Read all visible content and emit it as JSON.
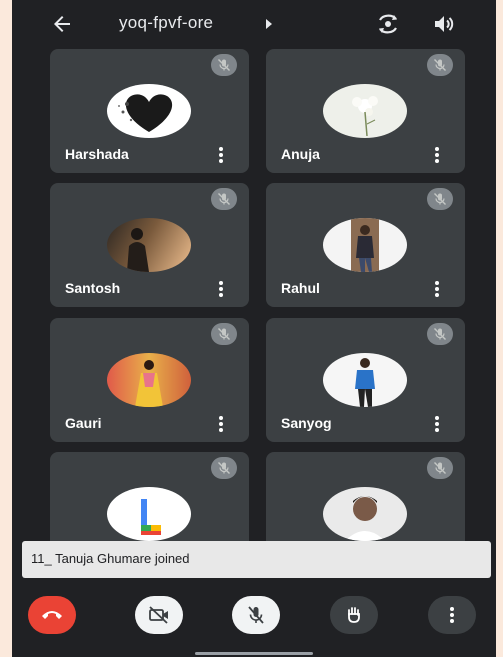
{
  "meeting": {
    "code": "yoq-fpvf-ore"
  },
  "participants": [
    {
      "name": "Harshada"
    },
    {
      "name": "Anuja"
    },
    {
      "name": "Santosh"
    },
    {
      "name": "Rahul"
    },
    {
      "name": "Gauri"
    },
    {
      "name": "Sanyog"
    },
    {
      "name": ""
    },
    {
      "name": ""
    }
  ],
  "toast": {
    "message": "11_ Tanuja Ghumare joined"
  },
  "colors": {
    "background": "#202124",
    "tile": "#3c4043",
    "end_call": "#ea4335",
    "mute_badge": "#80868b"
  },
  "icons": {
    "back": "arrow-left-icon",
    "caret": "caret-right-icon",
    "camera_switch": "camera-switch-icon",
    "speaker": "speaker-icon",
    "mic_off": "mic-off-icon",
    "more": "more-vertical-icon",
    "end_call": "phone-hangup-icon",
    "camera_off": "camera-off-icon",
    "raise_hand": "hand-icon"
  }
}
